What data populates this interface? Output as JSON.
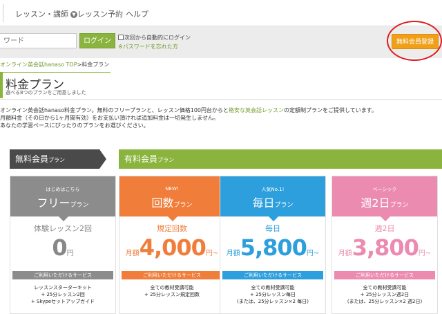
{
  "nav": {
    "items": [
      {
        "label": "レッスン・講師",
        "has_chevron": true
      },
      {
        "label": "レッスン予約"
      },
      {
        "label": "ヘルプ"
      }
    ]
  },
  "login": {
    "password_placeholder": "ワード",
    "login_button": "ログイン",
    "auto_login_label": "次回から自動的にログイン",
    "forgot_password": "※パスワードを忘れた方",
    "register_button": "無料会員登録"
  },
  "breadcrumb": {
    "link": "オンライン英会話hanaso TOP",
    "separator": ">",
    "current": "料金プラン"
  },
  "page": {
    "title": "料金プラン",
    "subtitle": "選べる8つのプランをご用意しました"
  },
  "intro": {
    "line1_a": "オンライン英会話hanaso料金プラン。無料のフリープランと、レッスン価格100円台からと",
    "line1_hl": "格安な英会話レッスン",
    "line1_b": "の定額制プランをご提供しています。",
    "line2": "月額料金（その日から1ヶ月間有効）をお支払い頂ければ追加料金は一切発生しません。",
    "line3": "あなたの学習ペースにぴったりのプランをお選びください。"
  },
  "categories": {
    "free": {
      "main": "無料会員",
      "suffix": "プラン"
    },
    "paid": {
      "main": "有料会員",
      "suffix": "プラン"
    }
  },
  "plans": [
    {
      "tag": "はじめはこちら",
      "name": "フリー",
      "name_suffix": "プラン",
      "count": "体験レッスン2回",
      "price_prefix": "",
      "price": "0",
      "price_suffix": "円",
      "service_label": "ご利用いただけるサービス",
      "features": [
        "レッスンスターターキット",
        "+ 25分レッスン2回",
        "+ Skypeセットアップガイド"
      ],
      "color": "#8c8c8c"
    },
    {
      "tag": "NEW!",
      "name": "回数",
      "name_suffix": "プラン",
      "count": "規定回数",
      "price_prefix": "月額",
      "price": "4,000",
      "price_suffix": "円~",
      "service_label": "ご利用いただけるサービス",
      "features": [
        "全ての教材受講可能",
        "+ 25分レッスン規定回数",
        ""
      ],
      "color": "#f07d3a"
    },
    {
      "tag": "人気No.1!",
      "name": "毎日",
      "name_suffix": "プラン",
      "count": "毎日",
      "price_prefix": "月額",
      "price": "5,800",
      "price_suffix": "円~",
      "service_label": "ご利用いただけるサービス",
      "features": [
        "全ての教材受講可能",
        "+ 25分レッスン毎日",
        "(または、25分レッスン×2 毎日)"
      ],
      "color": "#2d9fdc"
    },
    {
      "tag": "ベーシック",
      "name": "週2日",
      "name_suffix": "プラン",
      "count": "週2日",
      "price_prefix": "月額",
      "price": "3,800",
      "price_suffix": "円~",
      "service_label": "ご利用いただけるサービス",
      "features": [
        "全ての教材受講可能",
        "+ 25分レッスン週2日",
        "(または、25分レッスン×2 週2日)"
      ],
      "color": "#ec8bb0"
    }
  ]
}
